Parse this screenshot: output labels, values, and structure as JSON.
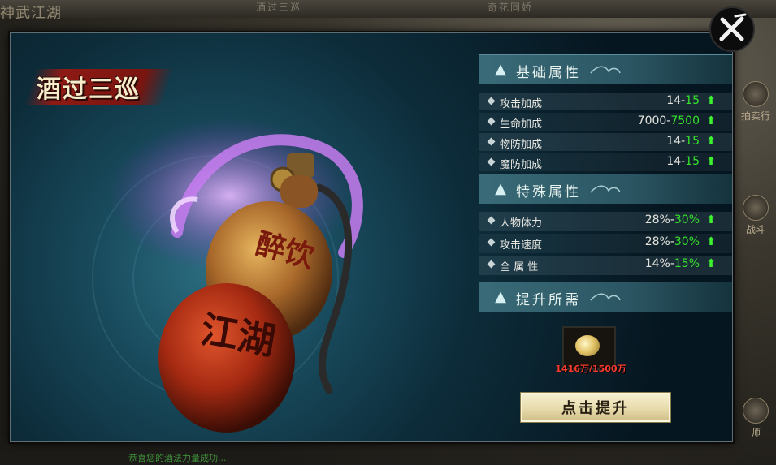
{
  "background": {
    "tabs": [
      "酒过三巡",
      "奇花同娇"
    ],
    "corner_logo": "神武江湖",
    "side_buttons": [
      "拍卖行",
      "战斗",
      "师"
    ],
    "bottom_message": "恭喜您的酒法力量成功..."
  },
  "panel": {
    "title": "酒过三巡",
    "gourd_text_top": "醉饮",
    "gourd_text_bottom": "江湖"
  },
  "sections": [
    {
      "title": "基础属性",
      "icon": "water-drop-icon",
      "rows": [
        {
          "label": "攻击加成",
          "current": "14",
          "next": "15"
        },
        {
          "label": "生命加成",
          "current": "7000",
          "next": "7500"
        },
        {
          "label": "物防加成",
          "current": "14",
          "next": "15"
        },
        {
          "label": "魔防加成",
          "current": "14",
          "next": "15"
        }
      ]
    },
    {
      "title": "特殊属性",
      "icon": "water-drop-icon",
      "rows": [
        {
          "label": "人物体力",
          "current": "28%",
          "next": "30%"
        },
        {
          "label": "攻击速度",
          "current": "28%",
          "next": "30%"
        },
        {
          "label": "全 属 性",
          "current": "14%",
          "next": "15%"
        }
      ]
    },
    {
      "title": "提升所需",
      "icon": "water-drop-icon"
    }
  ],
  "requirement": {
    "item_icon": "gold-coin-icon",
    "count_text": "1416万/1500万"
  },
  "buttons": {
    "upgrade": "点击提升",
    "close_icon": "close-x-icon"
  },
  "colors": {
    "increase_green": "#36e22c",
    "insufficient_red": "#ff3a2c",
    "panel_teal": "#184a5c"
  }
}
